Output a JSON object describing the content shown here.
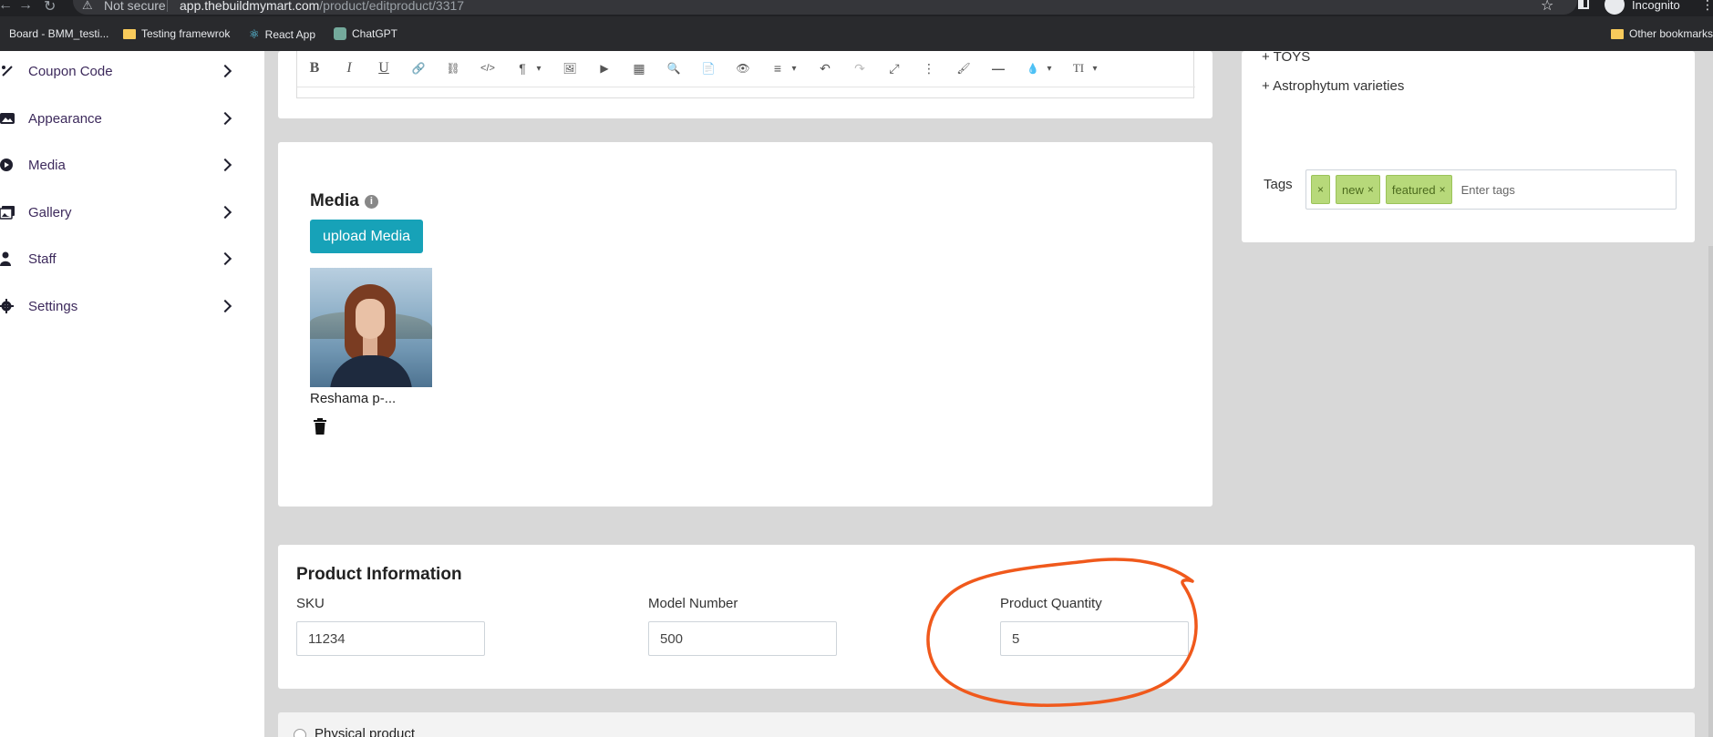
{
  "browser": {
    "security_text": "Not secure",
    "url_host": "app.thebuildmymart.com",
    "url_path": "/product/editproduct/3317",
    "profile_label": "Incognito",
    "bookmarks": [
      "Board - BMM_testi...",
      "Testing framewrok",
      "React App",
      "ChatGPT"
    ],
    "other_bookmarks": "Other bookmarks"
  },
  "sidebar": {
    "items": [
      {
        "label": "Coupon Code",
        "icon": "percent-icon"
      },
      {
        "label": "Appearance",
        "icon": "image-icon"
      },
      {
        "label": "Media",
        "icon": "play-circle-icon"
      },
      {
        "label": "Gallery",
        "icon": "images-icon"
      },
      {
        "label": "Staff",
        "icon": "user-icon"
      },
      {
        "label": "Settings",
        "icon": "gear-icon"
      }
    ]
  },
  "editor": {
    "tools": [
      "B",
      "I",
      "U",
      "🔗",
      "⛓",
      "</>",
      "¶",
      "▾",
      "🖼",
      "▶",
      "▦",
      "🔍",
      "📄",
      "👁",
      "≡",
      "▾",
      "↶",
      "↷",
      "⤢",
      "⋮",
      "🖌",
      "—",
      "💧",
      "▾",
      "TI",
      "▾"
    ]
  },
  "media": {
    "title": "Media",
    "upload_label": "upload Media",
    "file_name": "Reshama p-..."
  },
  "categories": {
    "items": [
      "+ TOYS",
      "+ Astrophytum varieties"
    ]
  },
  "tags": {
    "label": "Tags",
    "values": [
      "new",
      "featured"
    ],
    "placeholder": "Enter tags",
    "remove_symbol": "×"
  },
  "product_info": {
    "title": "Product Information",
    "sku_label": "SKU",
    "sku_value": "11234",
    "model_label": "Model Number",
    "model_value": "500",
    "quantity_label": "Product Quantity",
    "quantity_value": "5"
  },
  "product_type": {
    "physical_label": "Physical product"
  },
  "colors": {
    "accent": "#17a2b8",
    "annotation": "#f0591c",
    "tag_bg": "#b7d97a"
  }
}
